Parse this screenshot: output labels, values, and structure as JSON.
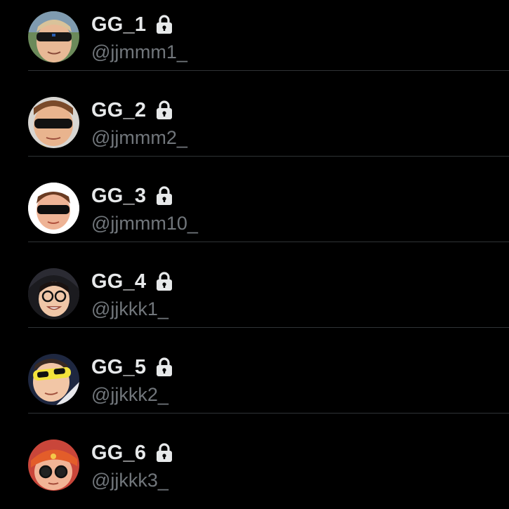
{
  "colors": {
    "background": "#000000",
    "name_text": "#e7e9ea",
    "handle_text": "#71767b",
    "divider": "#2f3336"
  },
  "accounts": [
    {
      "display_name": "GG_1",
      "handle": "@jjmmm1_",
      "protected_icon": "lock-icon"
    },
    {
      "display_name": "GG_2",
      "handle": "@jjmmm2_",
      "protected_icon": "lock-icon"
    },
    {
      "display_name": "GG_3",
      "handle": "@jjmmm10_",
      "protected_icon": "lock-icon"
    },
    {
      "display_name": "GG_4",
      "handle": "@jjkkk1_",
      "protected_icon": "lock-icon"
    },
    {
      "display_name": "GG_5",
      "handle": "@jjkkk2_",
      "protected_icon": "lock-icon"
    },
    {
      "display_name": "GG_6",
      "handle": "@jjkkk3_",
      "protected_icon": "lock-icon"
    }
  ]
}
